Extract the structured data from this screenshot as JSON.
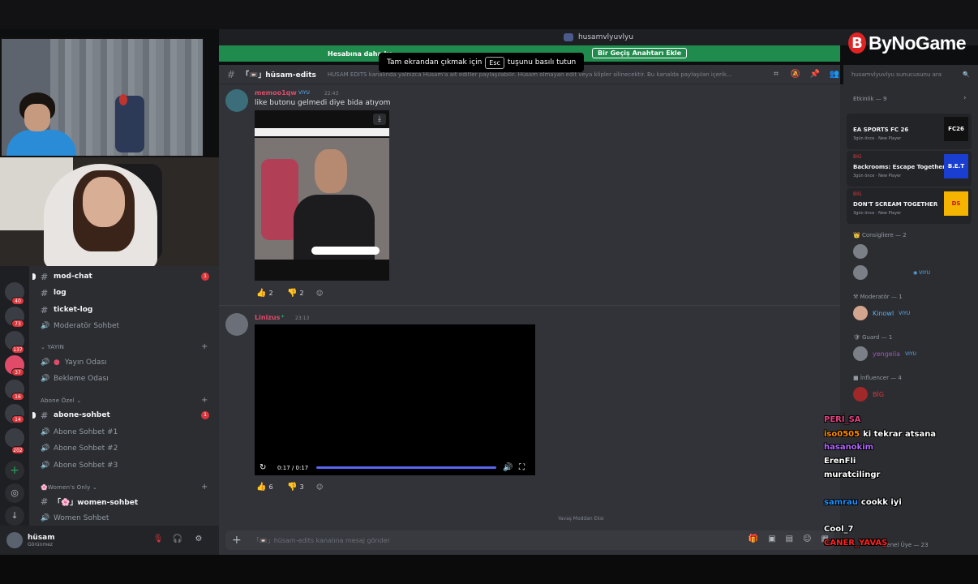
{
  "window": {
    "title": "husamvlyuvlyu"
  },
  "logo": {
    "text": "ByNoGame",
    "mark": "B"
  },
  "banner": {
    "text": "Hesabına daha kc",
    "button": "Bir Geçiş Anahtarı Ekle"
  },
  "esc_toast": {
    "prefix": "Tam ekrandan çıkmak için",
    "key": "Esc",
    "suffix": "tuşunu basılı tutun"
  },
  "channel_header": {
    "name": "「📼」hüsam-edits",
    "topic": "HÜSAM EDİTS kanalında yalnızca Hüsam'a ait editler paylaşılabilir. Hüsam olmayan edit veya klipler silinecektir. Bu kanalda paylaşılan içerik..."
  },
  "search": {
    "placeholder": "husamvlyuvlyu sunucusunu ara"
  },
  "servers": [
    {
      "badge": "40"
    },
    {
      "badge": "73"
    },
    {
      "badge": "137"
    },
    {
      "badge": "37"
    },
    {
      "badge": "16"
    },
    {
      "badge": "14"
    },
    {
      "badge": "202"
    }
  ],
  "channels": {
    "items": [
      {
        "name": "mod-chat",
        "unread": "1"
      },
      {
        "name": "log"
      },
      {
        "name": "ticket-log"
      },
      {
        "name": "Moderatör Sohbet"
      }
    ],
    "yayin_category": "YAYIN",
    "voice": [
      {
        "name": "Yayın Odası"
      },
      {
        "name": "Bekleme Odası"
      }
    ],
    "abone_category": "Abone Özel",
    "abone": [
      {
        "name": "abone-sohbet",
        "unread": "1"
      },
      {
        "name": "Abone Sohbet #1"
      },
      {
        "name": "Abone Sohbet #2"
      },
      {
        "name": "Abone Sohbet #3"
      }
    ],
    "women_category": "Women's Only",
    "women": [
      {
        "name": "「🌸」women-sohbet"
      },
      {
        "name": "Women Sohbet"
      }
    ]
  },
  "user": {
    "name": "hüsam",
    "status": "Görünmez"
  },
  "messages": [
    {
      "author": "memoo1qw",
      "author_color": "#e04b6a",
      "badge": "VIYU",
      "time": "22:43",
      "text": "like butonu gelmedi diye bida atıyom",
      "reactions": [
        {
          "emoji": "👍",
          "count": "2"
        },
        {
          "emoji": "👎",
          "count": "2"
        }
      ]
    },
    {
      "author": "Linizus",
      "author_color": "#e04b6a",
      "time": "23:13",
      "video": {
        "time": "0:17 / 0:17"
      },
      "reactions": [
        {
          "emoji": "👍",
          "count": "6"
        },
        {
          "emoji": "👎",
          "count": "3"
        }
      ]
    }
  ],
  "composer": {
    "placeholder": "「📼」hüsam-edits kanalına mesaj gönder"
  },
  "typing": "Yavaş Moddan Eksi",
  "members": {
    "activity_head": "Etkinlik — 9",
    "activities": [
      {
        "tag": "",
        "title": "EA SPORTS FC 26",
        "sub": "3gün önce · New Player",
        "img": "FC26",
        "img_bg": "#111111",
        "img_color": "#ffffff"
      },
      {
        "tag": "BİG",
        "title": "Backrooms: Escape Together",
        "sub": "3gün önce · New Player",
        "img": "B.E.T",
        "img_bg": "#1a3fd0",
        "img_color": "#ffffff"
      },
      {
        "tag": "BİG",
        "title": "DON'T SCREAM TOGETHER",
        "sub": "3gün önce · New Player",
        "img": "DS",
        "img_bg": "#f5b400",
        "img_color": "#c8101a"
      }
    ],
    "roles": [
      {
        "label": "Consigliere — 2"
      },
      {
        "label": "Moderatör — 1"
      },
      {
        "label": "Guard — 1"
      },
      {
        "label": "İnfluencer — 4"
      }
    ],
    "people": [
      {
        "name": "Kinowl",
        "color": "#5dadec",
        "badge": "VIYU"
      },
      {
        "name": "yengelia",
        "color": "#9b59b6",
        "badge": "VIYU"
      },
      {
        "name": "BİG",
        "color": "#da373c",
        "badge": ""
      }
    ],
    "bottom_role": "Genel Üye — 23"
  },
  "stream_chat": [
    {
      "user": "PERİ_SA",
      "color": "#e0427f",
      "msg": ""
    },
    {
      "user": "iso0505",
      "color": "#ff8c00",
      "msg": "ki tekrar atsana"
    },
    {
      "user": "hasanokim",
      "color": "#b266ff",
      "msg": ""
    },
    {
      "user": "ErenFli",
      "color": "#ffffff",
      "msg": ""
    },
    {
      "user": "muratcilingr",
      "color": "#ffffff",
      "msg": ""
    },
    {
      "user": "samrau",
      "color": "#1e90ff",
      "msg": "cookk iyi"
    },
    {
      "user": "Cool_7",
      "color": "#ffffff",
      "msg": ""
    },
    {
      "user": "CANER_YAVAŞ",
      "color": "#ff2020",
      "msg": ""
    }
  ]
}
